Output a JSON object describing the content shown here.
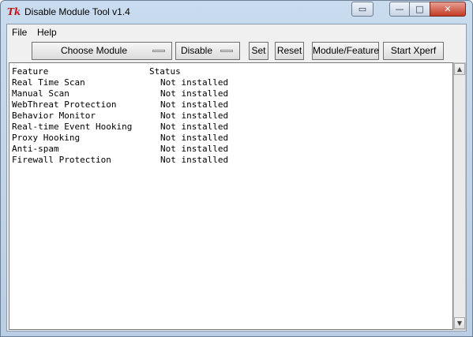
{
  "window": {
    "title": "Disable Module Tool v1.4",
    "app_icon_glyph": "Tk",
    "controls": {
      "extra": "▭",
      "minimize": "—",
      "maximize": "□",
      "close": "✕"
    }
  },
  "menu": {
    "file": "File",
    "help": "Help"
  },
  "toolbar": {
    "choose_module": "Choose Module",
    "action": "Disable",
    "set": "Set",
    "reset": "Reset",
    "module_feature": "Module/Feature",
    "start_xperf": "Start Xperf"
  },
  "table": {
    "headers": {
      "feature": "Feature",
      "status": "Status"
    },
    "rows": [
      {
        "feature": "Real Time Scan",
        "status": "Not installed"
      },
      {
        "feature": "Manual Scan",
        "status": "Not installed"
      },
      {
        "feature": "WebThreat Protection",
        "status": "Not installed"
      },
      {
        "feature": "Behavior Monitor",
        "status": "Not installed"
      },
      {
        "feature": "Real-time Event Hooking",
        "status": "Not installed"
      },
      {
        "feature": "Proxy Hooking",
        "status": "Not installed"
      },
      {
        "feature": "Anti-spam",
        "status": "Not installed"
      },
      {
        "feature": "Firewall Protection",
        "status": "Not installed"
      }
    ]
  },
  "scrollbar": {
    "up_icon": "▲",
    "down_icon": "▼"
  },
  "colors": {
    "title_gradient_top": "#c9dbee",
    "close_button": "#c23a25",
    "app_icon": "#c0161c"
  }
}
